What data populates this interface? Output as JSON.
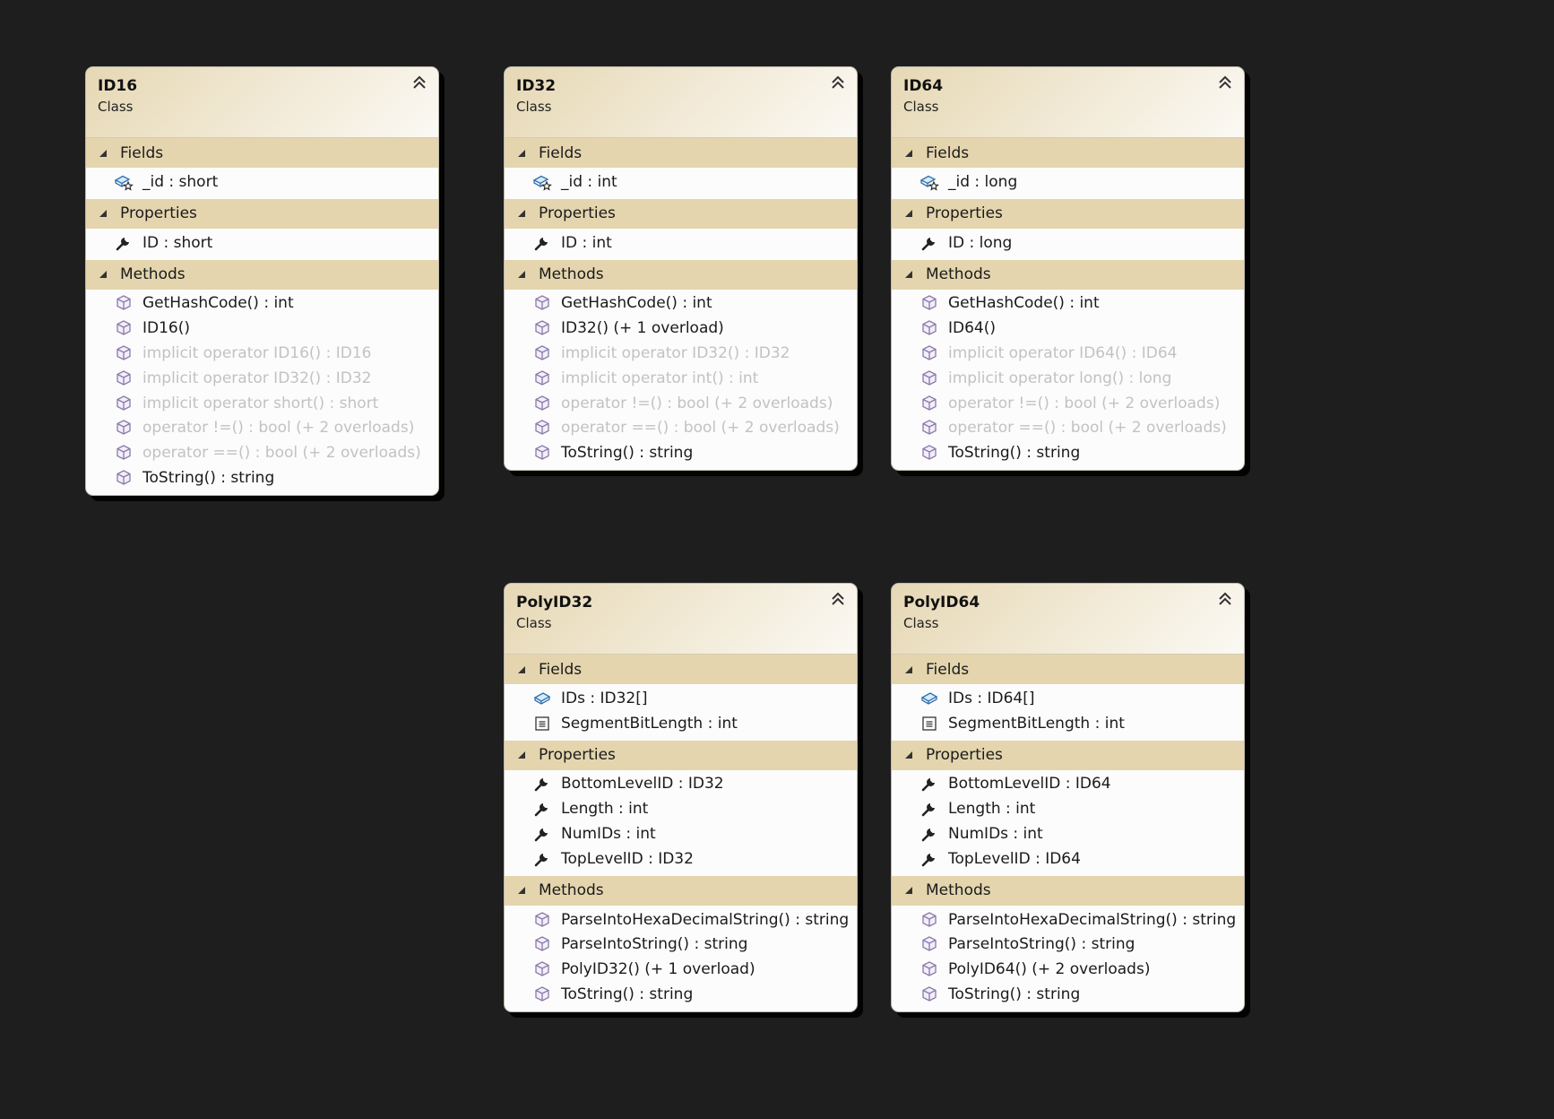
{
  "diagram": {
    "classes": [
      {
        "name": "ID16",
        "stereotype": "Class",
        "sections": [
          {
            "title": "Fields",
            "members": [
              {
                "icon": "protected-field-icon",
                "text": "_id : short"
              }
            ]
          },
          {
            "title": "Properties",
            "members": [
              {
                "icon": "wrench-icon",
                "text": "ID : short"
              }
            ]
          },
          {
            "title": "Methods",
            "members": [
              {
                "icon": "method-icon",
                "text": "GetHashCode() : int"
              },
              {
                "icon": "method-icon",
                "text": "ID16()"
              },
              {
                "icon": "method-icon",
                "text": "implicit operator ID16() : ID16",
                "dim": true
              },
              {
                "icon": "method-icon",
                "text": "implicit operator ID32() : ID32",
                "dim": true
              },
              {
                "icon": "method-icon",
                "text": "implicit operator short() : short",
                "dim": true
              },
              {
                "icon": "method-icon",
                "text": "operator !=() : bool (+ 2 overloads)",
                "dim": true
              },
              {
                "icon": "method-icon",
                "text": "operator ==() : bool (+ 2 overloads)",
                "dim": true
              },
              {
                "icon": "method-icon",
                "text": "ToString() : string"
              }
            ]
          }
        ]
      },
      {
        "name": "ID32",
        "stereotype": "Class",
        "sections": [
          {
            "title": "Fields",
            "members": [
              {
                "icon": "protected-field-icon",
                "text": "_id : int"
              }
            ]
          },
          {
            "title": "Properties",
            "members": [
              {
                "icon": "wrench-icon",
                "text": "ID : int"
              }
            ]
          },
          {
            "title": "Methods",
            "members": [
              {
                "icon": "method-icon",
                "text": "GetHashCode() : int"
              },
              {
                "icon": "method-icon",
                "text": "ID32() (+ 1 overload)"
              },
              {
                "icon": "method-icon",
                "text": "implicit operator ID32() : ID32",
                "dim": true
              },
              {
                "icon": "method-icon",
                "text": "implicit operator int() : int",
                "dim": true
              },
              {
                "icon": "method-icon",
                "text": "operator !=() : bool (+ 2 overloads)",
                "dim": true
              },
              {
                "icon": "method-icon",
                "text": "operator ==() : bool (+ 2 overloads)",
                "dim": true
              },
              {
                "icon": "method-icon",
                "text": "ToString() : string"
              }
            ]
          }
        ]
      },
      {
        "name": "ID64",
        "stereotype": "Class",
        "sections": [
          {
            "title": "Fields",
            "members": [
              {
                "icon": "protected-field-icon",
                "text": "_id : long"
              }
            ]
          },
          {
            "title": "Properties",
            "members": [
              {
                "icon": "wrench-icon",
                "text": "ID : long"
              }
            ]
          },
          {
            "title": "Methods",
            "members": [
              {
                "icon": "method-icon",
                "text": "GetHashCode() : int"
              },
              {
                "icon": "method-icon",
                "text": "ID64()"
              },
              {
                "icon": "method-icon",
                "text": "implicit operator ID64() : ID64",
                "dim": true
              },
              {
                "icon": "method-icon",
                "text": "implicit operator long() : long",
                "dim": true
              },
              {
                "icon": "method-icon",
                "text": "operator !=() : bool (+ 2 overloads)",
                "dim": true
              },
              {
                "icon": "method-icon",
                "text": "operator ==() : bool (+ 2 overloads)",
                "dim": true
              },
              {
                "icon": "method-icon",
                "text": "ToString() : string"
              }
            ]
          }
        ]
      },
      {
        "name": "PolyID32",
        "stereotype": "Class",
        "sections": [
          {
            "title": "Fields",
            "members": [
              {
                "icon": "field-icon",
                "text": "IDs : ID32[]"
              },
              {
                "icon": "constant-icon",
                "text": "SegmentBitLength : int"
              }
            ]
          },
          {
            "title": "Properties",
            "members": [
              {
                "icon": "wrench-icon",
                "text": "BottomLevelID : ID32"
              },
              {
                "icon": "wrench-icon",
                "text": "Length : int"
              },
              {
                "icon": "wrench-icon",
                "text": "NumIDs : int"
              },
              {
                "icon": "wrench-icon",
                "text": "TopLevelID : ID32"
              }
            ]
          },
          {
            "title": "Methods",
            "members": [
              {
                "icon": "method-icon",
                "text": "ParseIntoHexaDecimalString() : string"
              },
              {
                "icon": "method-icon",
                "text": "ParseIntoString() : string"
              },
              {
                "icon": "method-icon",
                "text": "PolyID32() (+ 1 overload)"
              },
              {
                "icon": "method-icon",
                "text": "ToString() : string"
              }
            ]
          }
        ]
      },
      {
        "name": "PolyID64",
        "stereotype": "Class",
        "sections": [
          {
            "title": "Fields",
            "members": [
              {
                "icon": "field-icon",
                "text": "IDs : ID64[]"
              },
              {
                "icon": "constant-icon",
                "text": "SegmentBitLength : int"
              }
            ]
          },
          {
            "title": "Properties",
            "members": [
              {
                "icon": "wrench-icon",
                "text": "BottomLevelID : ID64"
              },
              {
                "icon": "wrench-icon",
                "text": "Length : int"
              },
              {
                "icon": "wrench-icon",
                "text": "NumIDs : int"
              },
              {
                "icon": "wrench-icon",
                "text": "TopLevelID : ID64"
              }
            ]
          },
          {
            "title": "Methods",
            "members": [
              {
                "icon": "method-icon",
                "text": "ParseIntoHexaDecimalString() : string"
              },
              {
                "icon": "method-icon",
                "text": "ParseIntoString() : string"
              },
              {
                "icon": "method-icon",
                "text": "PolyID64() (+ 2 overloads)"
              },
              {
                "icon": "method-icon",
                "text": "ToString() : string"
              }
            ]
          }
        ]
      }
    ]
  }
}
